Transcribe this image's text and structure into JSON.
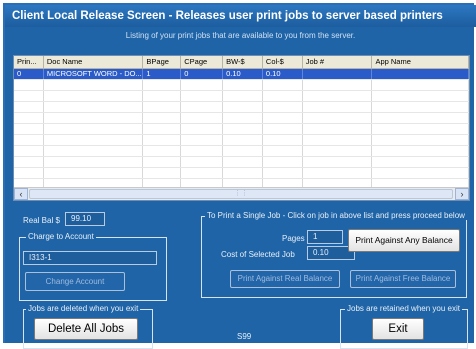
{
  "window": {
    "title": "Client Local Release Screen - Releases user print jobs to server based printers",
    "subtitle": "Listing of your print jobs that are available to you from the server."
  },
  "jobs_table": {
    "columns": [
      "Prin...",
      "Doc Name",
      "BPage",
      "CPage",
      "BW-$",
      "Col-$",
      "Job #",
      "App Name"
    ],
    "rows": [
      [
        "0",
        "MICROSOFT WORD - DO...",
        "1",
        "0",
        "0.10",
        "0.10",
        "",
        ""
      ]
    ]
  },
  "real_bal": {
    "label": "Real Bal $",
    "value": "99.10"
  },
  "charge": {
    "legend": "Charge to Account",
    "value": "I313-1",
    "button": "Change Account"
  },
  "single_job": {
    "legend": "To Print a Single Job - Click on job in above list and press proceed below",
    "pages_label": "Pages",
    "pages_value": "1",
    "cost_label": "Cost of Selected Job",
    "cost_value": "0.10",
    "print_any": "Print Against Any Balance",
    "print_real": "Print Against Real Balance",
    "print_free": "Print Against Free Balance"
  },
  "bottom": {
    "deleted_legend": "Jobs are deleted when you exit",
    "delete_all": "Delete All Jobs",
    "retained_legend": "Jobs are retained when you exit",
    "exit": "Exit",
    "code": "S99"
  }
}
